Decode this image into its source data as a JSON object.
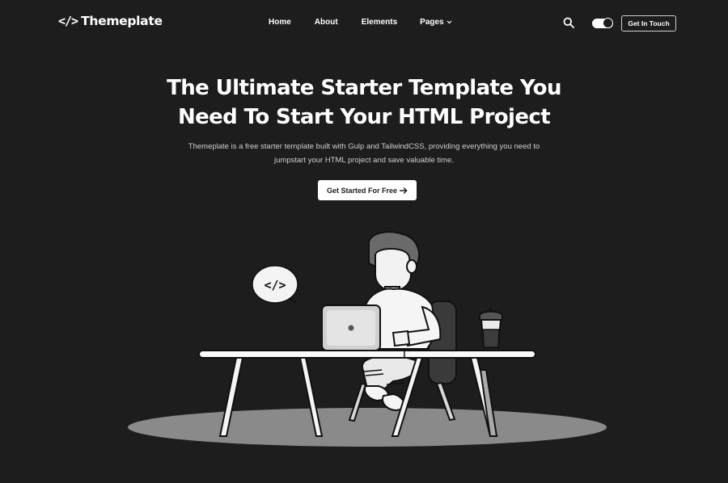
{
  "brand": {
    "logo_mark": "</>",
    "name": "Themeplate"
  },
  "nav": {
    "items": [
      "Home",
      "About",
      "Elements",
      "Pages"
    ]
  },
  "header_actions": {
    "search_icon": "search-icon",
    "theme_toggle": "dark-mode-toggle",
    "cta_label": "Get In Touch"
  },
  "hero": {
    "title_line1": "The Ultimate Starter Template You",
    "title_line2": "Need To Start Your HTML Project",
    "subtitle_line1": "Themeplate is a free starter template built with Gulp and TailwindCSS, providing everything you need to",
    "subtitle_line2": "jumpstart your HTML project and save valuable time.",
    "button_label": "Get Started For Free",
    "button_icon": "arrow-right-icon"
  },
  "illustration": {
    "speech_bubble_text": "</>"
  },
  "colors": {
    "background": "#1d1d1d",
    "text": "#ffffff",
    "muted": "#cfcfcf",
    "button_bg": "#ffffff"
  }
}
